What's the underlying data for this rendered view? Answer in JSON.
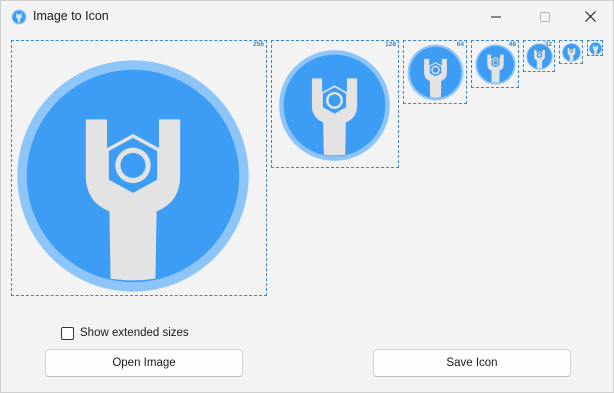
{
  "window": {
    "title": "Image to Icon",
    "controls": {
      "minimize": "minimize-icon",
      "maximize": "maximize-icon",
      "close": "close-icon"
    }
  },
  "previews": {
    "sizes": [
      "256",
      "128",
      "64",
      "48",
      "32",
      "24",
      "16"
    ],
    "icon": "wrench-nut-icon",
    "colors": {
      "outer_ring": "#8ec5f8",
      "fill": "#3d9cf4",
      "wrench": "#e3e3e3",
      "frame": "#3a86c6"
    }
  },
  "options": {
    "show_extended_label": "Show extended sizes",
    "show_extended_checked": false
  },
  "actions": {
    "open_label": "Open Image",
    "save_label": "Save Icon"
  }
}
